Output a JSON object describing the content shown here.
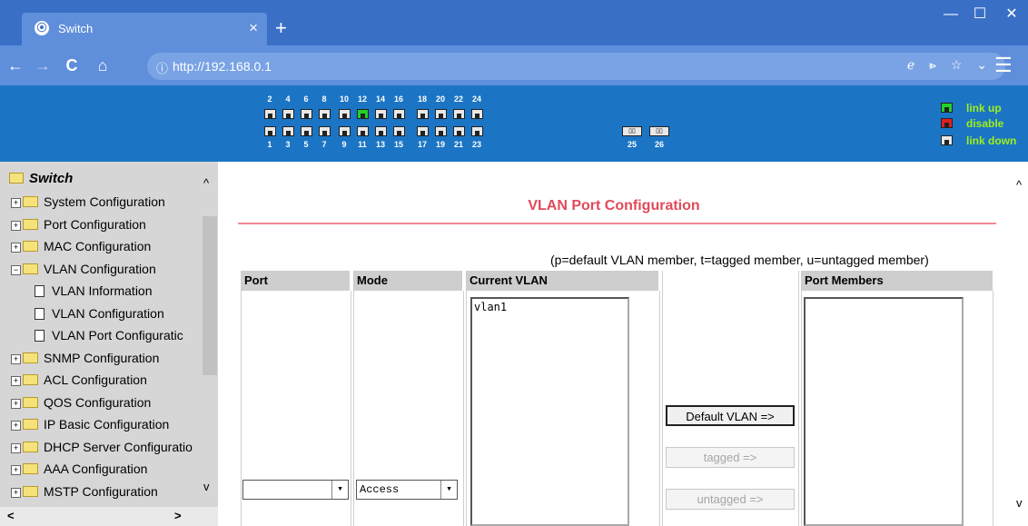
{
  "browser": {
    "tab_title": "Switch",
    "tab_close": "×",
    "new_tab": "+",
    "url": "http://192.168.0.1",
    "info_icon": "ⓘ",
    "right_icons": "ℯ ⩺ ☆ ⌄",
    "window_controls": {
      "minimize": "—",
      "maximize": "☐",
      "close": "✕"
    },
    "nav": {
      "back": "←",
      "forward": "→",
      "reload": "C",
      "home": "⌂"
    },
    "menu": "☰"
  },
  "port_panel": {
    "top_numbers": [
      "2",
      "4",
      "6",
      "8",
      "10",
      "12",
      "14",
      "16",
      "18",
      "20",
      "22",
      "24"
    ],
    "bottom_numbers": [
      "1",
      "3",
      "5",
      "7",
      "9",
      "11",
      "13",
      "15",
      "17",
      "19",
      "21",
      "23"
    ],
    "sfp_numbers": [
      "25",
      "26"
    ],
    "sfp_glyph": "▯▯",
    "link_up_port": "12",
    "legend": {
      "link_up": "link up",
      "disable": "disable",
      "link_down": "link down"
    },
    "colors": {
      "panel": "#1b75c4",
      "up": "#22d22a",
      "disable": "#e02020",
      "legend_text": "#9ef01a"
    }
  },
  "sidebar": {
    "root": "Switch",
    "items": [
      {
        "label": "System Configuration",
        "expander": "+"
      },
      {
        "label": "Port Configuration",
        "expander": "+"
      },
      {
        "label": "MAC Configuration",
        "expander": "+"
      },
      {
        "label": "VLAN Configuration",
        "expander": "−"
      },
      {
        "label": "VLAN Information",
        "child": true
      },
      {
        "label": "VLAN Configuration",
        "child": true
      },
      {
        "label": "VLAN Port Configuratic",
        "child": true
      },
      {
        "label": "SNMP Configuration",
        "expander": "+"
      },
      {
        "label": "ACL Configuration",
        "expander": "+"
      },
      {
        "label": "QOS Configuration",
        "expander": "+"
      },
      {
        "label": "IP Basic Configuration",
        "expander": "+"
      },
      {
        "label": "DHCP Server Configuratio",
        "expander": "+"
      },
      {
        "label": "AAA Configuration",
        "expander": "+"
      },
      {
        "label": "MSTP Configuration",
        "expander": "+"
      }
    ],
    "scroll_up": "^",
    "scroll_down": "v",
    "scroll_left": "<",
    "scroll_right": ">"
  },
  "main": {
    "title": "VLAN Port Configuration",
    "legend": "(p=default VLAN member, t=tagged member, u=untagged member)",
    "columns": {
      "port": "Port",
      "mode": "Mode",
      "current_vlan": "Current VLAN",
      "port_members": "Port Members"
    },
    "current_vlan_items": [
      "vlan1"
    ],
    "port_select_value": "",
    "mode_select_value": "Access",
    "select_arrow": "▾",
    "buttons": {
      "default_vlan": "Default  VLAN =>",
      "tagged": "tagged =>",
      "untagged": "untagged =>"
    },
    "colors": {
      "title": "#e04a5a",
      "rule": "#f18a93",
      "header_bg": "#cecece"
    },
    "scroll_up": "^",
    "scroll_down": "v"
  }
}
